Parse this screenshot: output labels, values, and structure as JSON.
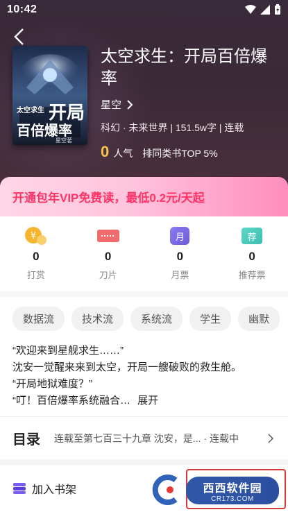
{
  "status": {
    "time": "10:42"
  },
  "book": {
    "title": "太空求生：开局百倍爆率",
    "author": "星空",
    "meta": "科幻 · 未来世界 | 151.5w字 | 连载",
    "popularity_value": "0",
    "popularity_label": "人气",
    "rank": "排同类书TOP 5%",
    "cover": {
      "title_line1": "开局",
      "title_line2": "百倍爆率",
      "prefix": "太空求生",
      "author": "星空著"
    }
  },
  "vip_banner": "开通包年VIP免费读，最低0.2元/天起",
  "rewards": [
    {
      "icon": "coin-reward-icon",
      "value": "0",
      "label": "打赏"
    },
    {
      "icon": "blade-icon",
      "value": "0",
      "label": "刀片"
    },
    {
      "icon": "monthly-ticket-icon",
      "value": "0",
      "label": "月票"
    },
    {
      "icon": "recommend-ticket-icon",
      "value": "0",
      "label": "推荐票"
    }
  ],
  "reward_icon_text": {
    "monthly": "月",
    "recommend": "荐"
  },
  "tags": [
    "数据流",
    "技术流",
    "系统流",
    "学生",
    "幽默"
  ],
  "synopsis": {
    "lines": [
      "“欢迎来到星舰求生……”",
      "沈安一觉醒来来到太空，开局一艘破败的救生舱。",
      "“开局地狱难度？”",
      "“叮！百倍爆率系统融合…"
    ],
    "expand_label": "展开"
  },
  "catalog": {
    "title": "目录",
    "latest": "连载至第七百三十九章 沈安，是... · 连载中"
  },
  "bottom": {
    "add_shelf_label": "加入书架"
  },
  "watermark": {
    "brand": "西西软件园",
    "url": "CR173.COM"
  },
  "colors": {
    "accent": "#ff3366",
    "gold": "#f8c349",
    "header_bg": "#3b2936"
  }
}
